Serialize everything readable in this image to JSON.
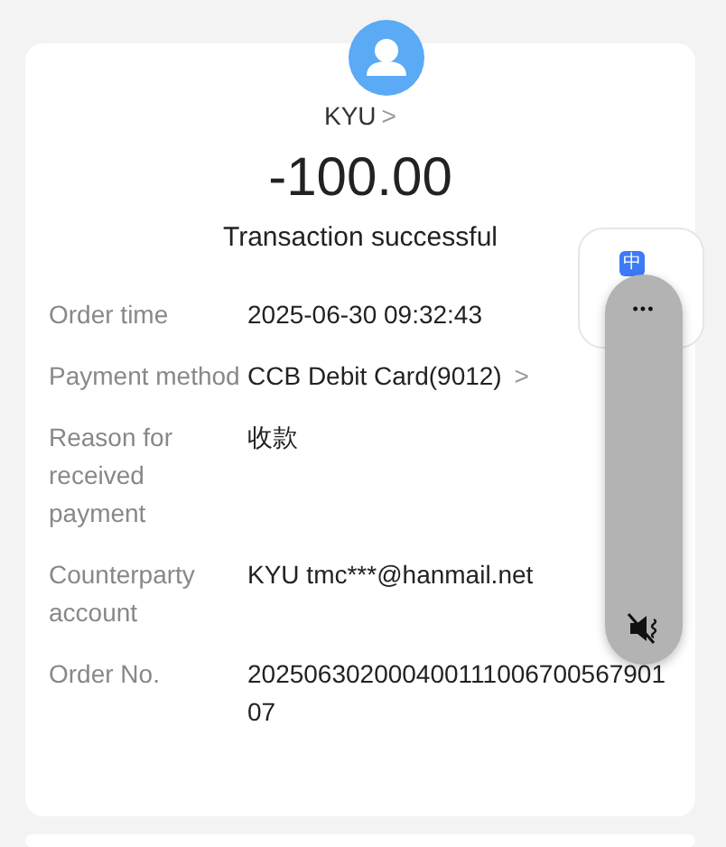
{
  "payee": {
    "name": "KYU",
    "chevron": ">"
  },
  "amount": "-100.00",
  "status": "Transaction successful",
  "details": [
    {
      "label": "Order time",
      "value": "2025-06-30 09:32:43"
    },
    {
      "label": "Payment method",
      "value": "CCB Debit Card(9012)",
      "chevron": ">"
    },
    {
      "label": "Reason for received payment",
      "value": "收款"
    },
    {
      "label": "Counterparty account",
      "value": "KYU tmc***@hanmail.net"
    },
    {
      "label": "Order No.",
      "value": "20250630200040011100670056790107"
    }
  ],
  "translate_widget": {
    "badge": "中"
  },
  "floating_panel": {
    "more": "•••"
  }
}
